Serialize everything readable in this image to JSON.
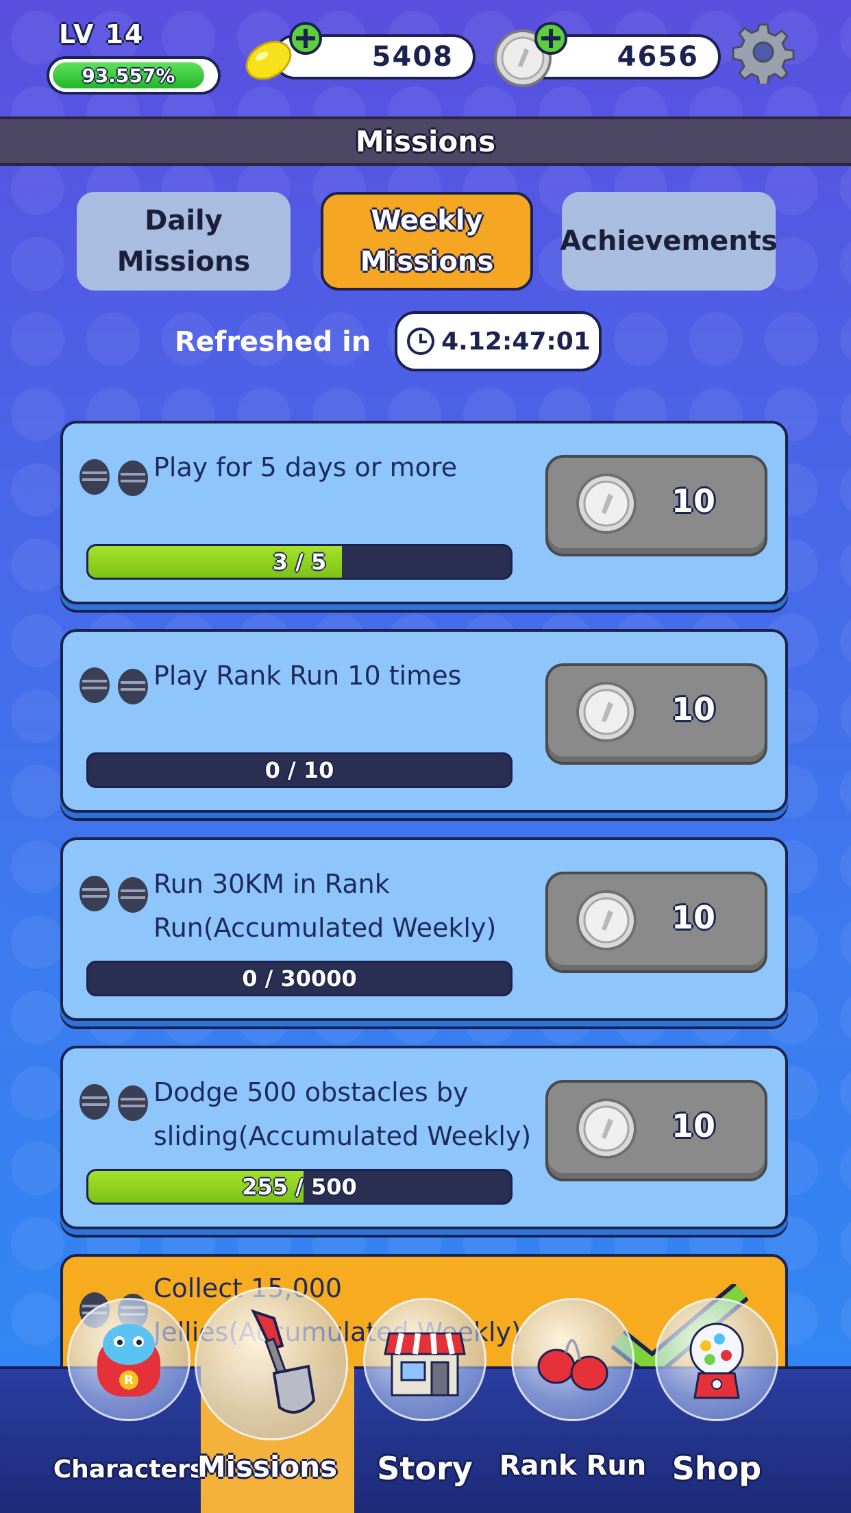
{
  "player": {
    "level_label": "LV 14",
    "xp_percent_label": "93.557%",
    "xp_fraction": 0.93557
  },
  "currency": {
    "jellies": "5408",
    "coins": "4656"
  },
  "header": {
    "title": "Missions"
  },
  "tabs": [
    {
      "label": "Daily\nMissions",
      "active": false
    },
    {
      "label": "Weekly\nMissions",
      "active": true
    },
    {
      "label": "Achievements",
      "active": false
    }
  ],
  "refresh": {
    "label": "Refreshed in",
    "timer": "4.12:47:01"
  },
  "missions": [
    {
      "title": "Play for 5 days or more",
      "progress_label": "3 / 5",
      "progress": 0.6,
      "reward": "10"
    },
    {
      "title": "Play Rank Run 10 times",
      "progress_label": "0 / 10",
      "progress": 0,
      "reward": "10"
    },
    {
      "title": "Run 30KM in Rank Run(Accumulated Weekly)",
      "progress_label": "0 / 30000",
      "progress": 0,
      "reward": "10"
    },
    {
      "title": "Dodge 500 obstacles by sliding(Accumulated Weekly)",
      "progress_label": "255 / 500",
      "progress": 0.51,
      "reward": "10"
    },
    {
      "title": "Collect 15,000 Jellies(Accumulated Weekly)"
    }
  ],
  "nav": [
    {
      "label": "Characters",
      "icon": "character-icon",
      "active": false
    },
    {
      "label": "Missions",
      "icon": "shovel-icon",
      "active": true
    },
    {
      "label": "Story",
      "icon": "store-icon",
      "active": false
    },
    {
      "label": "Rank Run",
      "icon": "boxing-gloves-icon",
      "active": false
    },
    {
      "label": "Shop",
      "icon": "gumball-machine-icon",
      "active": false
    }
  ],
  "colors": {
    "active_tab": "#f5a623",
    "card": "#8ec6fb",
    "progress_fill": "#8fd11f",
    "nav_bg": "#1d2a78"
  }
}
